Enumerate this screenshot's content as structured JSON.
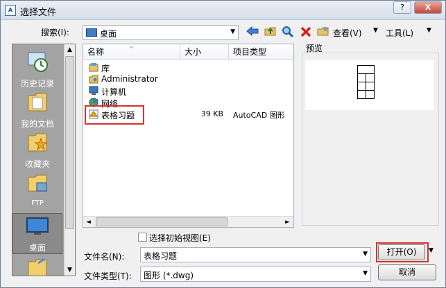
{
  "window": {
    "title": "选择文件",
    "help_label": "?",
    "close_label": "X"
  },
  "toolbar": {
    "search_label": "搜索(I):",
    "location": "桌面",
    "view_label": "查看(V)",
    "tools_label": "工具(L)"
  },
  "places": [
    {
      "label": "历史记录",
      "icon": "history-icon"
    },
    {
      "label": "我的文档",
      "icon": "documents-folder-icon"
    },
    {
      "label": "收藏夹",
      "icon": "favorites-folder-icon"
    },
    {
      "label": "FTP",
      "icon": "ftp-icon"
    },
    {
      "label": "桌面",
      "icon": "desktop-icon"
    }
  ],
  "filelist": {
    "columns": {
      "name": "名称",
      "size": "大小",
      "type": "项目类型"
    },
    "rows": [
      {
        "name": "库",
        "size": "",
        "type": "",
        "icon": "library-icon"
      },
      {
        "name": "Administrator",
        "size": "",
        "type": "",
        "icon": "user-folder-icon"
      },
      {
        "name": "计算机",
        "size": "",
        "type": "",
        "icon": "computer-icon"
      },
      {
        "name": "网络",
        "size": "",
        "type": "",
        "icon": "network-icon"
      },
      {
        "name": "表格习题",
        "size": "39 KB",
        "type": "AutoCAD 图形",
        "icon": "dwg-file-icon"
      }
    ]
  },
  "preview": {
    "label": "预览"
  },
  "form": {
    "initial_view_label": "选择初始视图(E)",
    "filename_label": "文件名(N):",
    "filename_value": "表格习题",
    "filetype_label": "文件类型(T):",
    "filetype_value": "图形 (*.dwg)",
    "open_label": "打开(O)",
    "cancel_label": "取消"
  },
  "colors": {
    "highlight_box": "#d9312c",
    "places_bg": "#a3a3a3"
  }
}
